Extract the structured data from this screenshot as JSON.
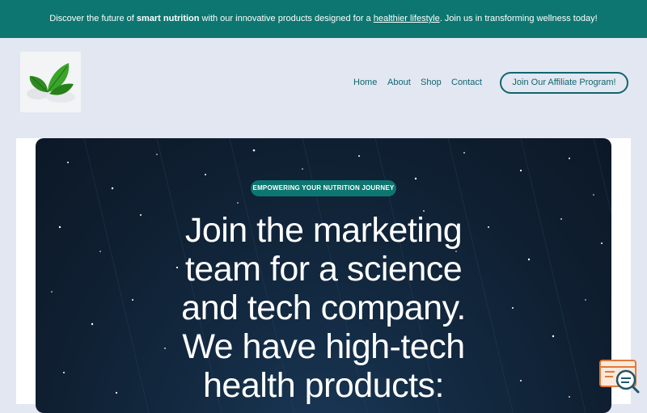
{
  "announcement": {
    "before": "Discover the future of ",
    "bold": "smart nutrition",
    "middle": " with our innovative products designed for a ",
    "link": "healthier lifestyle",
    "after": ". Join us in transforming wellness today!"
  },
  "nav": {
    "items": [
      {
        "label": "Home"
      },
      {
        "label": "About"
      },
      {
        "label": "Shop"
      },
      {
        "label": "Contact"
      }
    ],
    "cta_label": "Join Our Affiliate Program!"
  },
  "hero": {
    "eyebrow": "EMPOWERING YOUR NUTRITION JOURNEY",
    "headline_lines": [
      "Join the marketing",
      "team for a science",
      "and tech company.",
      "We have high-tech",
      "health products:"
    ]
  },
  "colors": {
    "brand_teal": "#0d7670",
    "page_bg": "#e3e7f1",
    "hero_bg": "#0f1f31"
  },
  "icons": {
    "logo": "green-leaves-logo",
    "chat": "chat-search-icon"
  }
}
